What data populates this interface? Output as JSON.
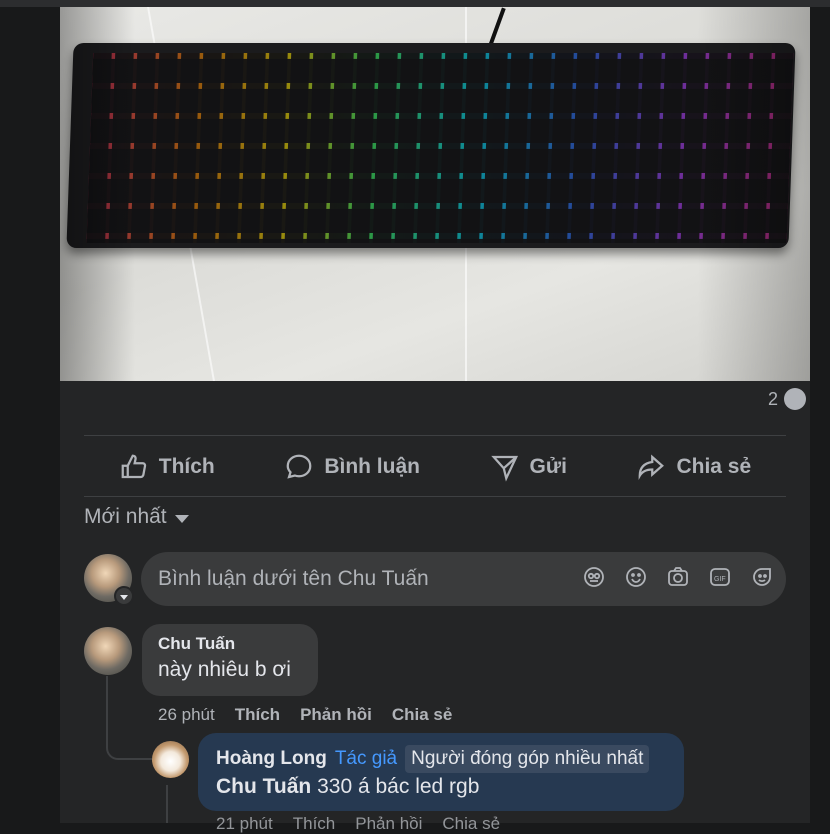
{
  "post": {
    "image_alt": "RGB mechanical keyboard photo",
    "comment_count": "2"
  },
  "actions": {
    "like": "Thích",
    "comment": "Bình luận",
    "send": "Gửi",
    "share": "Chia sẻ"
  },
  "sort": {
    "label": "Mới nhất"
  },
  "composer": {
    "placeholder": "Bình luận dưới tên Chu Tuấn"
  },
  "comments": [
    {
      "author": "Chu Tuấn",
      "text": "này nhiêu b ơi",
      "time": "26 phút",
      "like": "Thích",
      "reply": "Phản hồi",
      "share": "Chia sẻ",
      "replies": [
        {
          "author": "Hoàng Long",
          "role": "Tác giả",
          "badge": "Người đóng góp nhiều nhất",
          "mention": "Chu Tuấn",
          "text": "330 á bác led rgb",
          "time": "21 phút",
          "like": "Thích",
          "reply": "Phản hồi",
          "share": "Chia sẻ"
        }
      ]
    }
  ]
}
